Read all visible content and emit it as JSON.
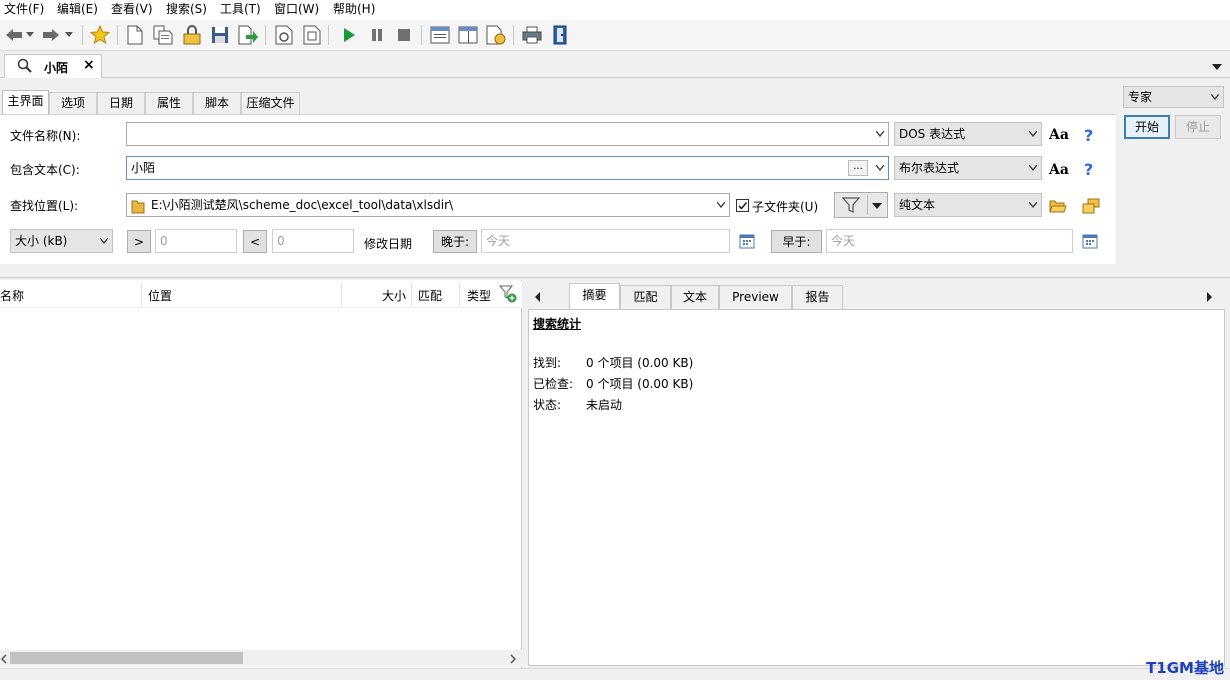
{
  "menu": [
    "文件(F)",
    "编辑(E)",
    "查看(V)",
    "搜索(S)",
    "工具(T)",
    "窗口(W)",
    "帮助(H)"
  ],
  "doc_tab": {
    "label": "小陌",
    "close": "×"
  },
  "mode": {
    "selected": "专家",
    "start_label": "开始",
    "stop_label": "停止"
  },
  "sub_tabs": [
    "主界面",
    "选项",
    "日期",
    "属性",
    "脚本",
    "压缩文件"
  ],
  "form": {
    "filename_label": "文件名称(N):",
    "filename_value": "",
    "filename_mode": "DOS 表达式",
    "content_label": "包含文本(C):",
    "content_value": "小陌",
    "content_ellipsis": "...",
    "content_mode": "布尔表达式",
    "location_label": "查找位置(L):",
    "location_value": "E:\\小陌测试楚风\\scheme_doc\\excel_tool\\data\\xlsdir\\",
    "subfolder_label": "子文件夹(U)",
    "subfolder_checked": true,
    "text_mode": "纯文本",
    "aa_label": "Aa",
    "help_label": "?",
    "size_unit": "大小 (kB)",
    "gt_label": ">",
    "gt_value": "0",
    "lt_label": "<",
    "lt_value": "0",
    "mdate_label": "修改日期",
    "after_label": "晚于:",
    "after_value": "今天",
    "before_label": "早于:",
    "before_value": "今天"
  },
  "results": {
    "columns": [
      "名称",
      "位置",
      "大小",
      "匹配",
      "类型"
    ]
  },
  "right_tabs": [
    "摘要",
    "匹配",
    "文本",
    "Preview",
    "报告"
  ],
  "summary": {
    "title": "搜索统计",
    "found_label": "找到:",
    "found_value": "0 个项目 (0.00 KB)",
    "checked_label": "已检查:",
    "checked_value": "0 个项目 (0.00 KB)",
    "status_label": "状态:",
    "status_value": "未启动"
  },
  "watermark": "T1GM基地",
  "colors": {
    "accent": "#3c7fb1",
    "help": "#2b6cd6",
    "play": "#1a9a3a"
  }
}
